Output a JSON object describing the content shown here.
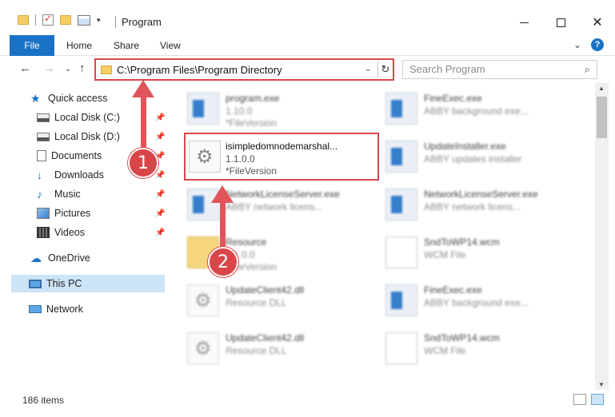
{
  "window": {
    "title": "Program",
    "minimize_icon": "minimize-icon",
    "maximize_icon": "maximize-icon",
    "close_icon": "close-icon"
  },
  "ribbon": {
    "file": "File",
    "home": "Home",
    "share": "Share",
    "view": "View",
    "accent_color": "#1a72c5"
  },
  "address_bar": {
    "path": "C:\\Program Files\\Program Directory"
  },
  "search": {
    "placeholder": "Search Program"
  },
  "sidebar": {
    "items": [
      {
        "label": "Quick access",
        "icon": "star-icon"
      },
      {
        "label": "Local Disk (C:)",
        "icon": "disk-icon",
        "pinned": true
      },
      {
        "label": "Local Disk (D:)",
        "icon": "disk-icon",
        "pinned": true
      },
      {
        "label": "Documents",
        "icon": "documents-icon",
        "pinned": true
      },
      {
        "label": "Downloads",
        "icon": "download-icon",
        "pinned": true
      },
      {
        "label": "Music",
        "icon": "music-icon",
        "pinned": true
      },
      {
        "label": "Pictures",
        "icon": "pictures-icon",
        "pinned": true
      },
      {
        "label": "Videos",
        "icon": "videos-icon",
        "pinned": true
      },
      {
        "label": "OneDrive",
        "icon": "cloud-icon"
      },
      {
        "label": "This PC",
        "icon": "computer-icon",
        "selected": true
      },
      {
        "label": "Network",
        "icon": "network-icon"
      }
    ]
  },
  "files": [
    {
      "name": "program.exe",
      "line1": "1.10.0",
      "line2": "*FileVersion",
      "icon": "exe-icon"
    },
    {
      "name": "FineExec.exe",
      "line1": "ABBY background exe...",
      "line2": "",
      "icon": "exe-icon"
    },
    {
      "name": "isimpledomnodemarshal...",
      "line1": "1.1.0.0",
      "line2": "*FileVersion",
      "icon": "gear-file-icon"
    },
    {
      "name": "UpdateInstaller.exe",
      "line1": "ABBY updates installer",
      "line2": "",
      "icon": "exe-icon"
    },
    {
      "name": "NetworkLicenseServer.exe",
      "line1": "ABBY network licens...",
      "line2": "",
      "icon": "exe-icon"
    },
    {
      "name": "NetworkLicenseServer.exe",
      "line1": "ABBY network licens...",
      "line2": "",
      "icon": "exe-icon"
    },
    {
      "name": "Resource",
      "line1": "1.1.0.0",
      "line2": "*FileVersion",
      "icon": "folder-icon"
    },
    {
      "name": "SndToWP14.wcm",
      "line1": "WCM File",
      "line2": "",
      "icon": "blank-file-icon"
    },
    {
      "name": "UpdateClient42.dll",
      "line1": "Resource DLL",
      "line2": "",
      "icon": "gear-file-icon"
    },
    {
      "name": "FineExec.exe",
      "line1": "ABBY background exe...",
      "line2": "",
      "icon": "exe-icon"
    },
    {
      "name": "UpdateClient42.dll",
      "line1": "Resource DLL",
      "line2": "",
      "icon": "gear-file-icon"
    },
    {
      "name": "SndToWP14.wcm",
      "line1": "WCM File",
      "line2": "",
      "icon": "blank-file-icon"
    }
  ],
  "status": {
    "item_count": "186 items"
  },
  "annotations": {
    "step1": "1",
    "step2": "2",
    "color": "#d9464a"
  }
}
